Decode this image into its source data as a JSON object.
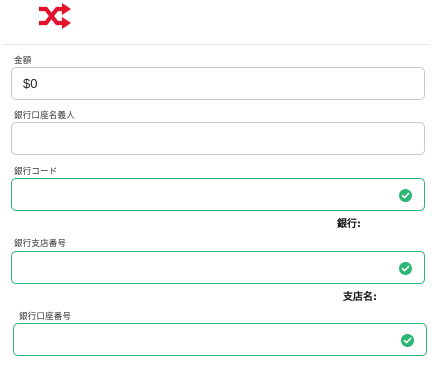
{
  "header": {
    "logo_icon": "shuffle-icon",
    "logo_color": "#e3132d"
  },
  "form": {
    "amount": {
      "label": "金額",
      "value": "$0"
    },
    "account_holder": {
      "label": "銀行口座名義人",
      "value": ""
    },
    "bank_code": {
      "label": "銀行コード",
      "value": "",
      "status_icon": "check-circle-icon"
    },
    "bank_name": {
      "label": "銀行:"
    },
    "branch_number": {
      "label": "銀行支店番号",
      "value": "",
      "status_icon": "check-circle-icon"
    },
    "branch_name": {
      "label": "支店名:"
    },
    "account_number": {
      "label": "銀行口座番号",
      "value": "",
      "status_icon": "check-circle-icon"
    }
  },
  "colors": {
    "valid": "#2bb673",
    "border": "#c9c9c9",
    "brand": "#e3132d"
  }
}
